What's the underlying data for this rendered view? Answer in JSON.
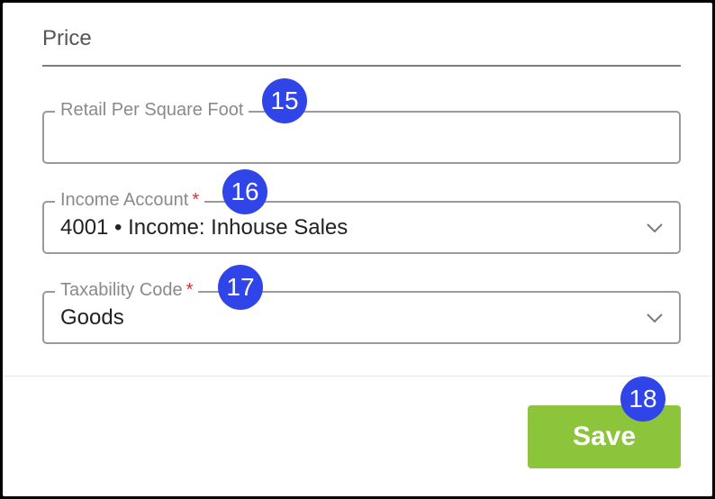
{
  "section": {
    "title": "Price"
  },
  "fields": {
    "retail_per_sqft": {
      "label": "Retail Per Square Foot",
      "value": "",
      "badge": "15"
    },
    "income_account": {
      "label": "Income Account",
      "required_mark": "*",
      "value": "4001 • Income: Inhouse Sales",
      "badge": "16"
    },
    "taxability_code": {
      "label": "Taxability Code",
      "required_mark": "*",
      "value": "Goods",
      "badge": "17"
    }
  },
  "actions": {
    "save_label": "Save",
    "save_badge": "18"
  },
  "colors": {
    "badge": "#2f45e8",
    "save_button": "#8cc43c",
    "required": "#d0343a"
  },
  "icons": {
    "dropdown": "chevron-down-icon"
  }
}
